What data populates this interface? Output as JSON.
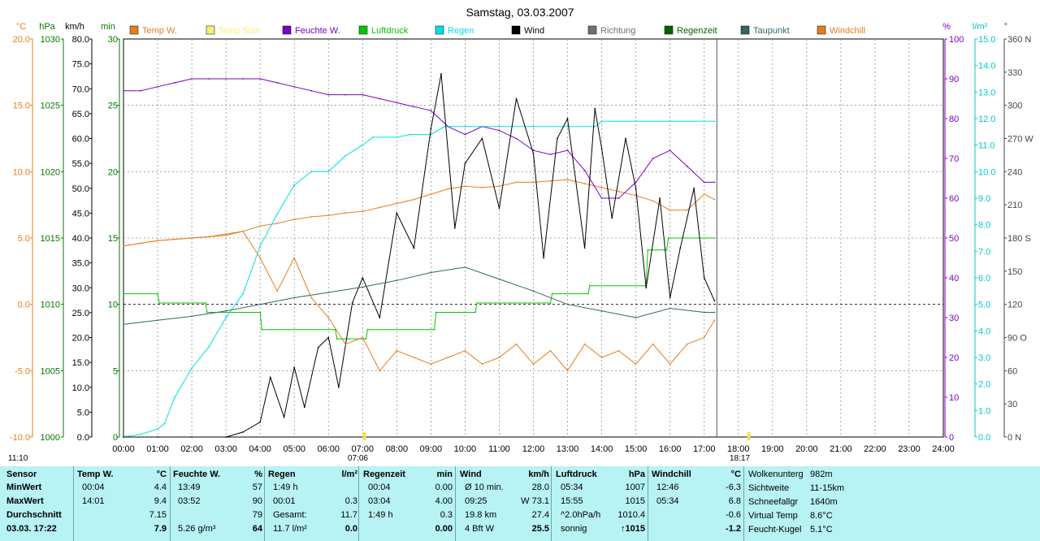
{
  "colors": {
    "temp": "#e87d1e",
    "temp5": "#f5f070",
    "humidity": "#7a00c8",
    "pressure": "#00c800",
    "rain": "#00e0e8",
    "wind": "#000000",
    "direction": "#707070",
    "raintime": "#006400",
    "dewpoint": "#336666",
    "windchill": "#e87d1e",
    "grid": "#909090",
    "axis_hum": "#7a00c8",
    "axis_rain": "#00c8c8",
    "axis_min": "#007800"
  },
  "chart_data": {
    "type": "line",
    "title": "Samstag, 03.03.2007",
    "x_ticks": [
      "00:00",
      "01:00",
      "02:00",
      "03:00",
      "04:00",
      "05:00",
      "06:00",
      "07:00",
      "08:00",
      "09:00",
      "10:00",
      "11:00",
      "12:00",
      "13:00",
      "14:00",
      "15:00",
      "16:00",
      "17:00",
      "18:00",
      "19:00",
      "20:00",
      "21:00",
      "22:00",
      "23:00",
      "24:00"
    ],
    "sunrise": "07:06",
    "sunset": "18:17",
    "now_time": "11:10",
    "axes": {
      "temp": {
        "unit": "°C",
        "ticks": [
          "20.0",
          "15.0",
          "10.0",
          "5.0",
          "0.0",
          "-5.0",
          "-10.0"
        ],
        "range": [
          -10,
          20
        ]
      },
      "pressure": {
        "unit": "hPa",
        "ticks": [
          "1030",
          "1025",
          "1020",
          "1015",
          "1010",
          "1005",
          "1000"
        ],
        "range": [
          1000,
          1030
        ]
      },
      "wind": {
        "unit": "km/h",
        "ticks": [
          "80.0",
          "75.0",
          "70.0",
          "65.0",
          "60.0",
          "55.0",
          "50.0",
          "45.0",
          "40.0",
          "35.0",
          "30.0",
          "25.0",
          "20.0",
          "15.0",
          "10.0",
          "5.0",
          "0.0"
        ],
        "range": [
          0,
          80
        ]
      },
      "minutes": {
        "unit": "min",
        "ticks": [
          "30",
          "25",
          "20",
          "15",
          "10",
          "5",
          "0"
        ],
        "range": [
          0,
          30
        ]
      },
      "humidity": {
        "unit": "%",
        "ticks": [
          "100",
          "90",
          "80",
          "70",
          "60",
          "50",
          "40",
          "30",
          "20",
          "10",
          "0"
        ],
        "range": [
          0,
          100
        ]
      },
      "rain": {
        "unit": "l/m²",
        "ticks": [
          "15.0",
          "14.0",
          "13.0",
          "12.0",
          "11.0",
          "10.0",
          "9.0",
          "8.0",
          "7.0",
          "6.0",
          "5.0",
          "4.0",
          "3.0",
          "2.0",
          "1.0",
          "0.0"
        ],
        "range": [
          0,
          15
        ]
      },
      "direction": {
        "unit": "°",
        "ticks": [
          "360 N",
          "330",
          "300",
          "270 W",
          "240",
          "210",
          "180 S",
          "150",
          "120",
          "90 O",
          "60",
          "30",
          "0 N"
        ],
        "range": [
          0,
          360
        ]
      }
    },
    "legend": [
      "Temp W.",
      "Temp 5cm",
      "Feuchte W.",
      "Luftdruck",
      "Regen",
      "Wind",
      "Richtung",
      "Regenzeit",
      "Taupunkt",
      "Windchill"
    ],
    "series": [
      {
        "name": "Temp W.",
        "x": [
          0,
          0.5,
          1,
          1.5,
          2,
          2.5,
          3,
          3.5,
          4,
          4.5,
          5,
          5.5,
          6,
          6.5,
          7,
          7.5,
          8,
          8.5,
          9,
          9.5,
          10,
          10.5,
          11,
          11.5,
          12,
          12.5,
          13,
          13.5,
          14,
          14.5,
          15,
          15.5,
          16,
          16.5,
          17,
          17.3
        ],
        "values": [
          4.4,
          4.6,
          4.8,
          4.9,
          5.0,
          5.1,
          5.3,
          5.5,
          5.9,
          6.1,
          6.4,
          6.6,
          6.7,
          6.9,
          7.0,
          7.3,
          7.6,
          7.9,
          8.3,
          8.7,
          8.9,
          8.8,
          8.9,
          9.2,
          9.2,
          9.3,
          9.4,
          9.1,
          8.8,
          8.5,
          8.2,
          7.8,
          7.1,
          7.1,
          8.3,
          7.9
        ]
      },
      {
        "name": "Feuchte W.",
        "x": [
          0,
          0.5,
          1,
          1.5,
          2,
          2.5,
          3,
          3.5,
          4,
          4.5,
          5,
          5.5,
          6,
          6.5,
          7,
          7.5,
          8,
          8.5,
          9,
          9.5,
          10,
          10.5,
          11,
          11.5,
          12,
          12.5,
          13,
          13.5,
          14,
          14.5,
          15,
          15.5,
          16,
          16.5,
          17,
          17.3
        ],
        "values": [
          87,
          87,
          88,
          89,
          90,
          90,
          90,
          90,
          90,
          89,
          88,
          87,
          86,
          86,
          86,
          85,
          84,
          83,
          82,
          78,
          76,
          78,
          77,
          75,
          72,
          71,
          72,
          67,
          60,
          60,
          64,
          70,
          72,
          68,
          64,
          64
        ]
      },
      {
        "name": "Luftdruck",
        "x": [
          0,
          1,
          1.05,
          2.4,
          2.45,
          4,
          4.05,
          6.2,
          6.25,
          7.1,
          7.15,
          9.1,
          9.15,
          10.3,
          10.35,
          12.5,
          12.55,
          13.6,
          13.65,
          15.3,
          15.35,
          15.9,
          15.95,
          17.3
        ],
        "values": [
          1010.8,
          1010.8,
          1010.1,
          1010.1,
          1009.4,
          1009.4,
          1008.1,
          1008.1,
          1007.4,
          1007.4,
          1008.1,
          1008.1,
          1009.4,
          1009.4,
          1010.1,
          1010.1,
          1010.8,
          1010.8,
          1011.4,
          1011.4,
          1014.1,
          1014.1,
          1015,
          1015
        ]
      },
      {
        "name": "Regen",
        "x": [
          0,
          0.5,
          1,
          1.2,
          1.5,
          2,
          2.5,
          3,
          3.5,
          4,
          4.5,
          5,
          5.5,
          6,
          6.5,
          7,
          7.3,
          8,
          8.4,
          9,
          9.4,
          10,
          11,
          12,
          13,
          13.8,
          14,
          15,
          16,
          17,
          17.3
        ],
        "values": [
          0,
          0.1,
          0.3,
          0.5,
          1.5,
          2.6,
          3.4,
          4.5,
          5.4,
          7.2,
          8.4,
          9.5,
          10.0,
          10.0,
          10.6,
          11.0,
          11.3,
          11.3,
          11.4,
          11.4,
          11.7,
          11.7,
          11.7,
          11.7,
          11.7,
          11.7,
          11.9,
          11.9,
          11.9,
          11.9,
          11.9
        ]
      },
      {
        "name": "Wind",
        "x": [
          0,
          1,
          2,
          3,
          3.5,
          4,
          4.3,
          4.7,
          5,
          5.3,
          5.7,
          6,
          6.3,
          6.7,
          7,
          7.5,
          8,
          8.5,
          9,
          9.3,
          9.7,
          10,
          10.5,
          11,
          11.5,
          12,
          12.3,
          12.7,
          13,
          13.5,
          13.8,
          14,
          14.3,
          14.7,
          15,
          15.3,
          15.7,
          16,
          16.3,
          16.7,
          17,
          17.3
        ],
        "values": [
          0,
          0,
          0,
          0,
          1,
          3,
          12,
          4,
          14,
          6,
          18,
          20,
          10,
          27,
          32,
          24,
          45,
          38,
          62,
          73,
          42,
          55,
          60,
          46,
          68,
          57,
          36,
          60,
          64,
          38,
          66,
          58,
          44,
          60,
          50,
          30,
          48,
          28,
          38,
          50,
          32,
          27.4
        ]
      },
      {
        "name": "Taupunkt",
        "x": [
          0,
          1,
          2,
          3,
          4,
          5,
          6,
          7,
          8,
          9,
          10,
          11,
          12,
          13,
          14,
          15,
          16,
          17,
          17.3
        ],
        "values": [
          -1.5,
          -1.2,
          -0.9,
          -0.5,
          0.0,
          0.5,
          0.9,
          1.3,
          1.8,
          2.4,
          2.8,
          1.9,
          1.0,
          0.0,
          -0.5,
          -1.0,
          -0.3,
          -0.6,
          -0.6
        ]
      },
      {
        "name": "Windchill",
        "x": [
          0,
          1,
          2,
          3,
          3.5,
          4,
          4.5,
          5,
          5.5,
          6,
          6.5,
          7,
          7.5,
          8,
          8.5,
          9,
          9.5,
          10,
          10.5,
          11,
          11.5,
          12,
          12.5,
          13,
          13.5,
          14,
          14.5,
          15,
          15.5,
          16,
          16.5,
          17,
          17.3
        ],
        "values": [
          4.4,
          4.8,
          5.0,
          5.2,
          5.5,
          3.5,
          1.0,
          3.5,
          0.5,
          -1.0,
          -3.0,
          -2.5,
          -5.0,
          -3.5,
          -4.0,
          -4.5,
          -4.0,
          -3.5,
          -4.5,
          -4.0,
          -3.0,
          -4.5,
          -3.5,
          -5.0,
          -3.0,
          -4.0,
          -3.5,
          -4.5,
          -3.0,
          -4.5,
          -3.0,
          -2.5,
          -1.2
        ]
      }
    ]
  },
  "stats": {
    "headers": {
      "sensor": "Sensor",
      "temp": "Temp W.",
      "temp_unit": "°C",
      "hum": "Feuchte W.",
      "hum_unit": "%",
      "rain": "Regen",
      "rain_unit": "l/m²",
      "raintime": "Regenzeit",
      "raintime_unit": "min",
      "wind": "Wind",
      "wind_unit": "km/h",
      "press": "Luftdruck",
      "press_unit": "hPa",
      "chill": "Windchill",
      "chill_unit": "°C"
    },
    "rowlabels": [
      "MinWert",
      "MaxWert",
      "Durchschnitt",
      "03.03. 17:22"
    ],
    "temp": [
      [
        "00:04",
        "4.4"
      ],
      [
        "14:01",
        "9.4"
      ],
      [
        "",
        "7.15"
      ],
      [
        "",
        "7.9"
      ]
    ],
    "hum": [
      [
        "13:49",
        "57"
      ],
      [
        "03:52",
        "90"
      ],
      [
        "",
        "79"
      ],
      [
        "5.26 g/m³",
        "64"
      ]
    ],
    "rain": [
      [
        "1:49 h",
        ""
      ],
      [
        "00:01",
        "0.3"
      ],
      [
        "Gesamt:",
        "11.7"
      ],
      [
        "11.7 l/m²",
        "0.0"
      ]
    ],
    "raintime": [
      [
        "00:04",
        "0.00"
      ],
      [
        "03:04",
        "4.00"
      ],
      [
        "1:49 h",
        "0.3"
      ],
      [
        "",
        "0.00"
      ]
    ],
    "wind": [
      [
        "Ø 10 min.",
        "28.0"
      ],
      [
        "09:25",
        "W 73.1"
      ],
      [
        "19.8 km",
        "27.4"
      ],
      [
        "4 Bft W",
        "25.5"
      ]
    ],
    "press": [
      [
        "05:34",
        "1007"
      ],
      [
        "15:55",
        "1015"
      ],
      [
        "^2.0hPa/h",
        "1010.4"
      ],
      [
        "sonnig",
        "↑1015"
      ]
    ],
    "chill": [
      [
        "12:46",
        "-6.3"
      ],
      [
        "05:34",
        "6.8"
      ],
      [
        "",
        "-0.6"
      ],
      [
        "",
        "-1.2"
      ]
    ],
    "extra": [
      [
        "Wolkenunterg",
        "982m"
      ],
      [
        "Sichtweite",
        "11-15km"
      ],
      [
        "Schneefallgr",
        "1640m"
      ],
      [
        "Virtual Temp",
        "8.6°C"
      ],
      [
        "Feucht-Kugel",
        "5.1°C"
      ]
    ]
  }
}
